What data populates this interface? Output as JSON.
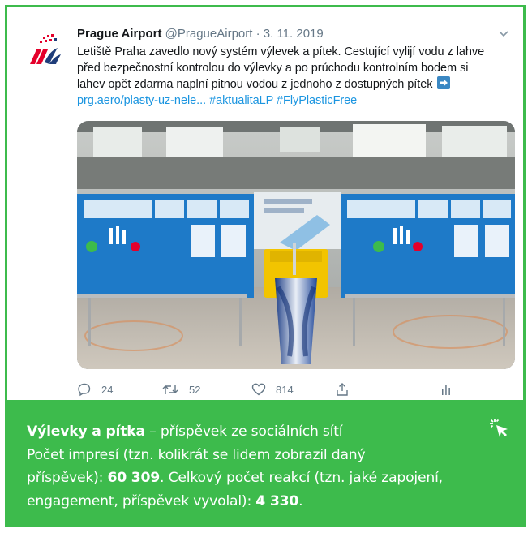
{
  "tweet": {
    "author_name": "Prague Airport",
    "author_handle": "@PragueAirport",
    "separator": " · ",
    "date": "3. 11. 2019",
    "text_lines": [
      "Letiště Praha zavedlo nový systém výlevek a pítek. Cestující vylijí vodu z lahve",
      "před bezpečnostní kontrolou do výlevky a po průchodu kontrolním bodem si",
      "lahev opět zdarma naplní pitnou vodou z jednoho z dostupných pítek"
    ],
    "links": {
      "url": "prg.aero/plasty-uz-nele...",
      "hashtag1": "#aktualitaLP",
      "hashtag2": "#FlyPlasticFree"
    },
    "actions": {
      "reply_count": "24",
      "retweet_count": "52",
      "like_count": "814"
    },
    "icons": {
      "avatar": "prague-airport-logo-icon",
      "menu": "chevron-down-icon",
      "reply": "reply-icon",
      "retweet": "retweet-icon",
      "like": "heart-icon",
      "share": "share-icon",
      "analytics": "analytics-icon",
      "emoji": "right-arrow-emoji-icon"
    }
  },
  "caption": {
    "title": "Výlevky a pítka",
    "subtitle": " – příspěvek ze sociálních sítí",
    "line2": "Počet impresí (tzn. kolikrát se lidem zobrazil daný",
    "line3_prefix": "příspěvek): ",
    "impressions": "60 309",
    "line3_suffix": ". Celkový počet reakcí (tzn. jaké zapojení,",
    "line4_prefix": "engagement, příspěvek vyvolal): ",
    "reactions": "4 330",
    "line4_suffix": ".",
    "icon": "click-cursor-icon"
  },
  "colors": {
    "accent_green": "#3dbb4c",
    "link_blue": "#1b95e0",
    "muted_gray": "#657786"
  }
}
